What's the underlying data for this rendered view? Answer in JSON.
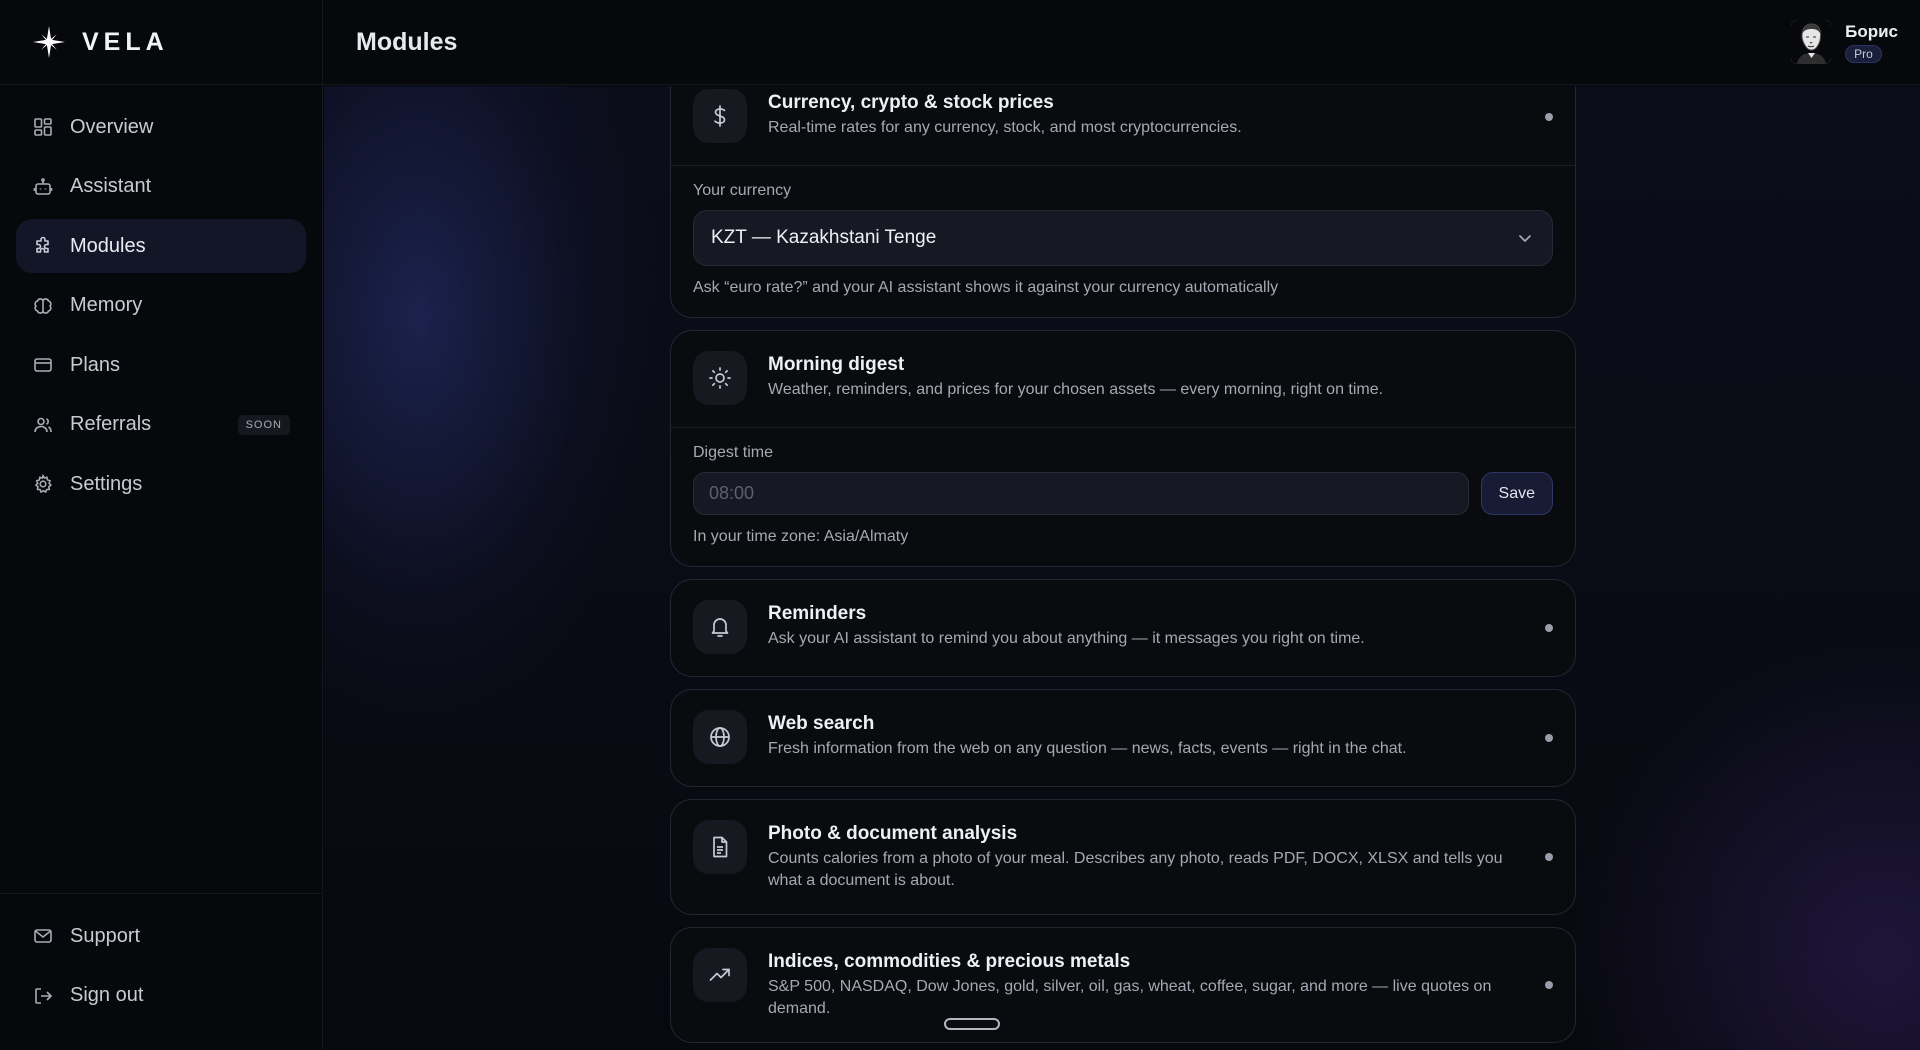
{
  "brand": {
    "name": "VELA"
  },
  "header": {
    "title": "Modules"
  },
  "user": {
    "name": "Борис",
    "plan": "Pro"
  },
  "sidebar": {
    "items": [
      {
        "label": "Overview"
      },
      {
        "label": "Assistant"
      },
      {
        "label": "Modules"
      },
      {
        "label": "Memory"
      },
      {
        "label": "Plans"
      },
      {
        "label": "Referrals",
        "badge": "SOON"
      },
      {
        "label": "Settings"
      }
    ],
    "bottom": [
      {
        "label": "Support"
      },
      {
        "label": "Sign out"
      }
    ]
  },
  "modules": {
    "currency": {
      "title": "Currency, crypto & stock prices",
      "desc": "Real-time rates for any currency, stock, and most cryptocurrencies.",
      "field_label": "Your currency",
      "selected": "KZT — Kazakhstani Tenge",
      "hint": "Ask “euro rate?” and your AI assistant shows it against your currency automatically"
    },
    "digest": {
      "title": "Morning digest",
      "desc": "Weather, reminders, and prices for your chosen assets — every morning, right on time.",
      "field_label": "Digest time",
      "placeholder": "08:00",
      "save_label": "Save",
      "hint": "In your time zone: Asia/Almaty"
    },
    "reminders": {
      "title": "Reminders",
      "desc": "Ask your AI assistant to remind you about anything — it messages you right on time."
    },
    "websearch": {
      "title": "Web search",
      "desc": "Fresh information from the web on any question — news, facts, events — right in the chat."
    },
    "photo": {
      "title": "Photo & document analysis",
      "desc": "Counts calories from a photo of your meal. Describes any photo, reads PDF, DOCX, XLSX and tells you what a document is about."
    },
    "indices": {
      "title": "Indices, commodities & precious metals",
      "desc": "S&P 500, NASDAQ, Dow Jones, gold, silver, oil, gas, wheat, coffee, sugar, and more — live quotes on demand."
    }
  },
  "colors": {
    "accent": "#131627",
    "background": "#07080c",
    "card": "#0a0b0f"
  }
}
